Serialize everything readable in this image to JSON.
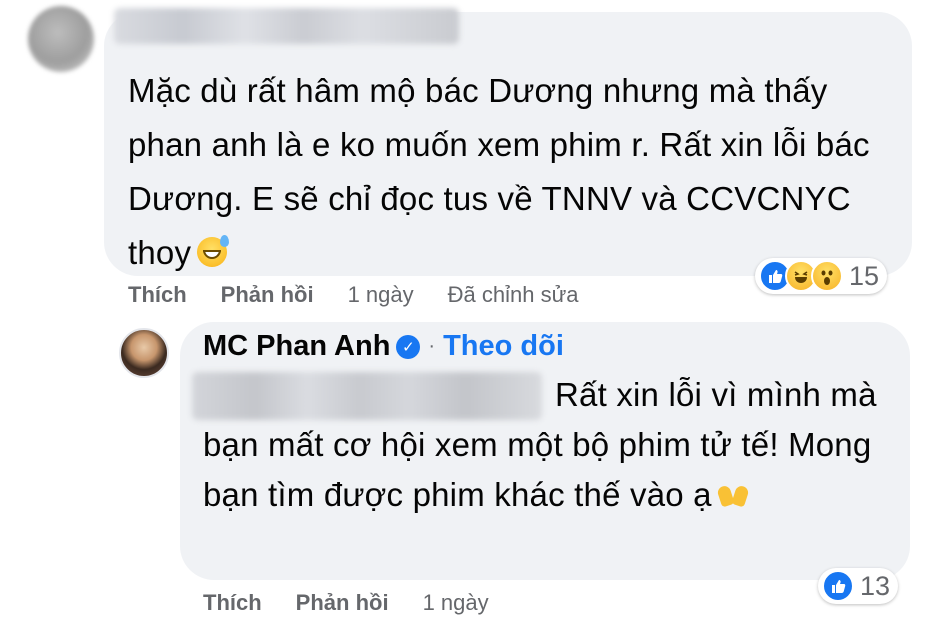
{
  "comment": {
    "text": "Mặc dù rất hâm mộ bác Dương nhưng mà thấy phan anh là e ko muốn xem phim r. Rất xin lỗi bác Dương. E sẽ chỉ đọc tus về TNNV và CCVCNYC thoy",
    "emoji": "sweat-smile-emoji",
    "actions": {
      "like": "Thích",
      "reply": "Phản hồi",
      "time": "1 ngày",
      "edited": "Đã chỉnh sửa"
    },
    "reactions": {
      "types": [
        "like",
        "haha",
        "wow"
      ],
      "count": "15"
    }
  },
  "reply": {
    "author": "MC Phan Anh",
    "follow_label": "Theo dõi",
    "separator": "·",
    "text": "Rất xin lỗi vì mình mà bạn mất cơ hội xem một bộ phim tử tế! Mong bạn tìm được phim khác thế vào ạ",
    "emoji": "raising-hands-emoji",
    "actions": {
      "like": "Thích",
      "reply": "Phản hồi",
      "time": "1 ngày"
    },
    "reactions": {
      "types": [
        "like"
      ],
      "count": "13"
    }
  },
  "colors": {
    "bubble": "#f0f2f5",
    "accent": "#1877f2",
    "secondary_text": "#65676b",
    "primary_text": "#050505"
  }
}
